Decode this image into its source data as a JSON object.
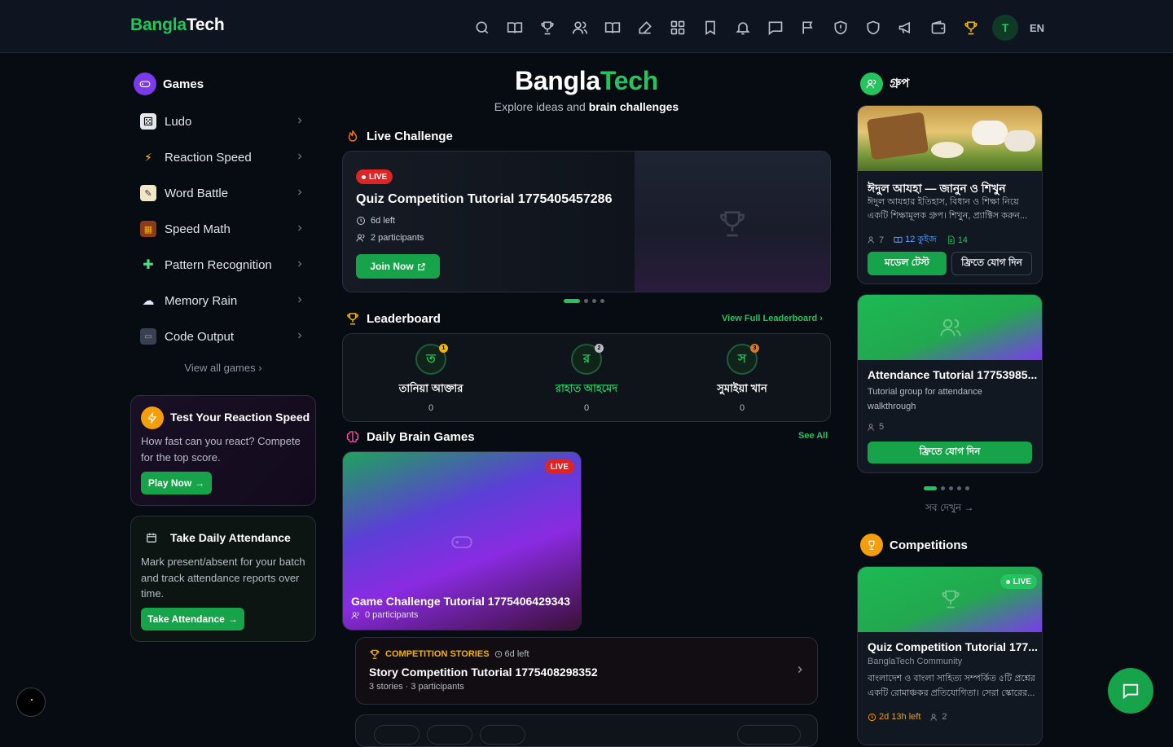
{
  "brand": {
    "part1": "Bangla",
    "part2": "Tech"
  },
  "nav": {
    "icons": [
      "search-icon",
      "book-open-icon",
      "trophy-icon",
      "users-icon",
      "book-icon",
      "edit-icon",
      "grid-icon",
      "bookmark-icon",
      "bell-icon",
      "message-icon",
      "flag-icon",
      "shield-alert-icon",
      "shield-icon",
      "megaphone-icon",
      "wallet-icon",
      "trophy-gold-icon"
    ],
    "avatar_letter": "T",
    "lang": "EN"
  },
  "sidebar": {
    "title": "Games",
    "games": [
      {
        "label": "Ludo",
        "icon": "dice-icon"
      },
      {
        "label": "Reaction Speed",
        "icon": "lightning-icon"
      },
      {
        "label": "Word Battle",
        "icon": "memo-icon"
      },
      {
        "label": "Speed Math",
        "icon": "abacus-icon"
      },
      {
        "label": "Pattern Recognition",
        "icon": "puzzle-icon"
      },
      {
        "label": "Memory Rain",
        "icon": "rain-cloud-icon"
      },
      {
        "label": "Code Output",
        "icon": "laptop-icon"
      }
    ],
    "view_all": "View all games",
    "reaction": {
      "title": "Test Your Reaction Speed",
      "desc": "How fast can you react? Compete for the top score.",
      "button": "Play Now"
    },
    "attendance": {
      "title": "Take Daily Attendance",
      "desc": "Mark present/absent for your batch and track attendance reports over time.",
      "button": "Take Attendance"
    }
  },
  "center": {
    "brand1": "Bangla",
    "brand2": "Tech",
    "tag_plain": "Explore ideas and",
    "tag_bold": "brain challenges",
    "live": {
      "section": "Live Challenge",
      "badge": "LIVE",
      "title": "Quiz Competition Tutorial 1775405457286",
      "time_left": "6d left",
      "participants": "2 participants",
      "button": "Join Now"
    },
    "leaderboard": {
      "section": "Leaderboard",
      "link": "View Full Leaderboard",
      "entries": [
        {
          "initial": "ত",
          "name": "তানিয়া আক্তার",
          "score": "0",
          "rank": "1",
          "medal_color": "#f5b400",
          "name_color": "#ffffff"
        },
        {
          "initial": "র",
          "name": "রাহাত আহমেদ",
          "score": "0",
          "rank": "2",
          "medal_color": "#b8bec8",
          "name_color": "#22c55e"
        },
        {
          "initial": "স",
          "name": "সুমাইয়া খান",
          "score": "0",
          "rank": "3",
          "medal_color": "#d9772b",
          "name_color": "#ffffff"
        }
      ]
    },
    "brain": {
      "section": "Daily Brain Games",
      "link": "See All",
      "game": {
        "badge": "LIVE",
        "title": "Game Challenge Tutorial 1775406429343",
        "participants": "0 participants"
      }
    },
    "story": {
      "category": "COMPETITION STORIES",
      "time_left": "6d left",
      "title": "Story Competition Tutorial 1775408298352",
      "meta": "3 stories · 3 participants"
    }
  },
  "right": {
    "groups_title": "গ্রুপ",
    "group1": {
      "title": "ঈদুল আযহা — জানুন ও শিখুন",
      "desc": "ঈদুল আযহার ইতিহাস, বিধান ও শিক্ষা নিয়ে একটি শিক্ষামূলক গ্রুপ। শিখুন, প্র্যাক্টিস করুন...",
      "members": "7",
      "quiz": "12 কুইজ",
      "docs": "14",
      "btn1": "মডেল টেস্ট",
      "btn2": "ফ্রিতে যোগ দিন"
    },
    "group2": {
      "title": "Attendance Tutorial 17753985...",
      "desc": "Tutorial group for attendance walkthrough",
      "members": "5",
      "button": "ফ্রিতে যোগ দিন"
    },
    "see_all": "সব দেখুন",
    "competitions_title": "Competitions",
    "comp": {
      "badge": "LIVE",
      "title": "Quiz Competition Tutorial 177...",
      "org": "BanglaTech Community",
      "desc": "বাংলাদেশ ও বাংলা সাহিত্য সম্পর্কিত ৫টি প্রশ্নের একটি রোমাঞ্চকর প্রতিযোগিতা। সেরা স্কোরের...",
      "time": "2d 13h left",
      "participants": "2"
    }
  },
  "colors": {
    "accent": "#22c55e",
    "live": "#dc2626",
    "bg": "#070b12"
  }
}
